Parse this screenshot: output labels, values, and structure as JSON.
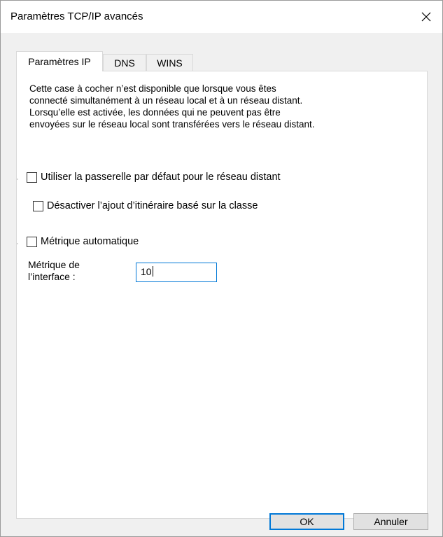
{
  "window": {
    "title": "Paramètres TCP/IP avancés",
    "close_icon": "close-icon",
    "accent_color": "#0078d7"
  },
  "tabs": [
    {
      "label": "Paramètres IP",
      "active": true
    },
    {
      "label": "DNS",
      "active": false
    },
    {
      "label": "WINS",
      "active": false
    }
  ],
  "description": [
    "Cette case à cocher n’est disponible que lorsque vous êtes",
    "connecté simultanément à un réseau local et à un réseau distant.",
    "Lorsqu’elle est activée, les données qui ne peuvent pas être",
    "envoyées sur le réseau local sont transférées vers le réseau distant."
  ],
  "gateway_group": {
    "use_default_gateway_label": "Utiliser la passerelle par défaut pour le réseau distant",
    "use_default_gateway_checked": false,
    "disable_class_route_label": "Désactiver l’ajout d’itinéraire basé sur la classe",
    "disable_class_route_checked": false
  },
  "metric_group": {
    "automatic_metric_label": "Métrique automatique",
    "automatic_metric_checked": false,
    "interface_metric_label_line1": "Métrique de",
    "interface_metric_label_line2": "l’interface :",
    "interface_metric_value": "10"
  },
  "buttons": {
    "ok_label": "OK",
    "cancel_label": "Annuler"
  }
}
